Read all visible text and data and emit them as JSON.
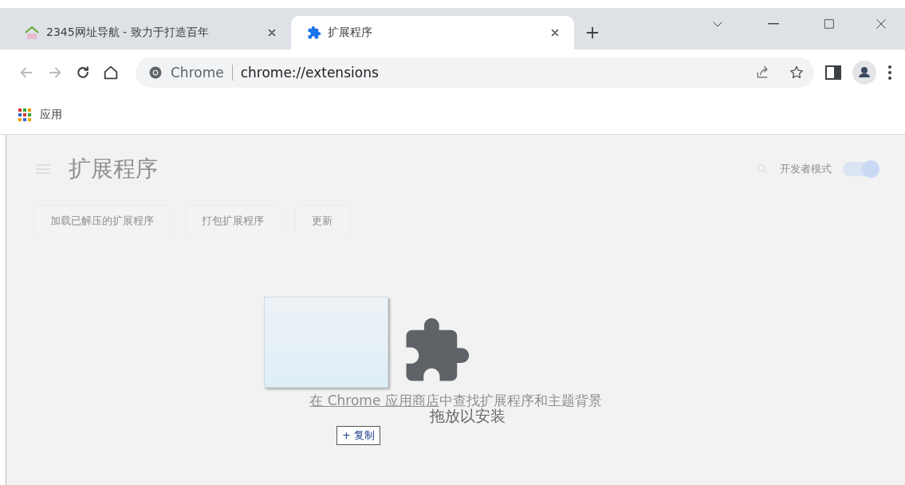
{
  "tabs": [
    {
      "title": "2345网址导航 - 致力于打造百年",
      "kind": "site",
      "selected": false
    },
    {
      "title": "扩展程序",
      "kind": "extension",
      "selected": true
    }
  ],
  "address_bar": {
    "origin": "Chrome",
    "url": "chrome://extensions"
  },
  "bookmarks": [
    {
      "label": "应用"
    }
  ],
  "page": {
    "title": "扩展程序",
    "developer_mode": {
      "label": "开发者模式",
      "on": true
    },
    "buttons": [
      "加载已解压的扩展程序",
      "打包扩展程序",
      "更新"
    ],
    "store_link": {
      "prefix": "在 Chrome 应用商店",
      "rest": "中查找扩展程序和主题背景"
    }
  },
  "drop_overlay": {
    "label": "拖放以安装",
    "drag_badge": "+ 复制"
  }
}
